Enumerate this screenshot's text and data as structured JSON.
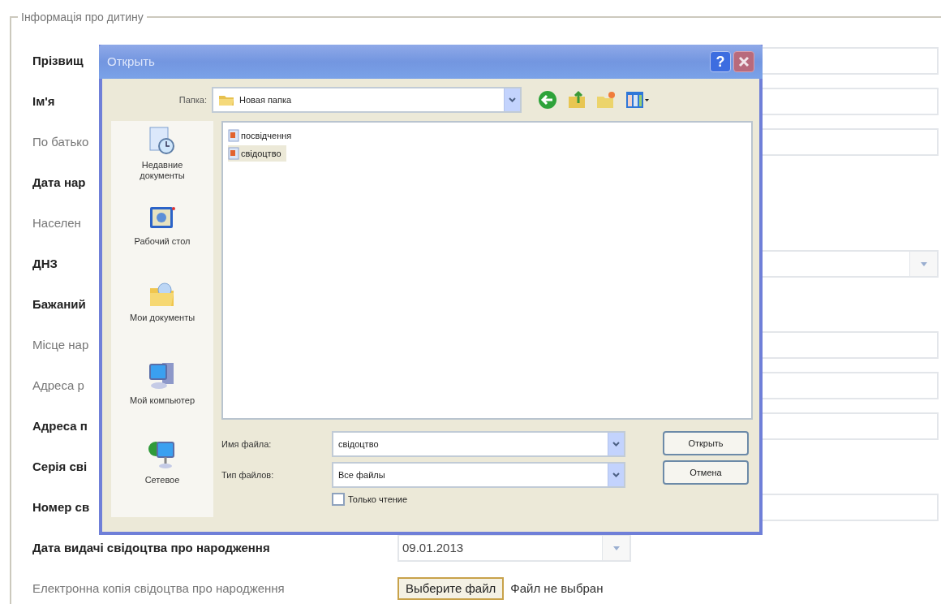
{
  "form": {
    "legend": "Інформація про дитину",
    "rows": [
      {
        "label": "Прізвищ",
        "required": true,
        "control": {
          "kind": "text"
        }
      },
      {
        "label": "Ім'я",
        "required": true,
        "control": {
          "kind": "text"
        }
      },
      {
        "label": "По батько",
        "required": false,
        "control": {
          "kind": "text"
        }
      },
      {
        "label": "Дата нар",
        "required": true,
        "control": {
          "kind": "none"
        }
      },
      {
        "label": "Населен",
        "required": false,
        "control": {
          "kind": "none"
        }
      },
      {
        "label": "ДНЗ",
        "required": true,
        "control": {
          "kind": "select"
        }
      },
      {
        "label": "Бажаний",
        "required": true,
        "control": {
          "kind": "none"
        }
      },
      {
        "label": "Місце нар",
        "required": false,
        "control": {
          "kind": "text"
        }
      },
      {
        "label": "Адреса р",
        "required": false,
        "control": {
          "kind": "text"
        }
      },
      {
        "label": "Адреса п",
        "required": true,
        "control": {
          "kind": "text"
        }
      },
      {
        "label": "Серія сві",
        "required": true,
        "control": {
          "kind": "none"
        }
      },
      {
        "label": "Номер св",
        "required": true,
        "control": {
          "kind": "text"
        }
      },
      {
        "label": "Дата видачі свідоцтва про народження",
        "required": true,
        "control": {
          "kind": "date",
          "value": "09.01.2013"
        }
      },
      {
        "label": "Електронна копія свідоцтва про народження",
        "required": false,
        "control": {
          "kind": "file",
          "button": "Выберите файл",
          "status": "Файл не выбран"
        }
      }
    ]
  },
  "dialog": {
    "title": "Открыть",
    "help": "?",
    "folder_label": "Папка:",
    "folder": "Новая папка",
    "places": [
      {
        "label": "Недавние документы",
        "kind": "recent"
      },
      {
        "label": "Рабочий стол",
        "kind": "desktop"
      },
      {
        "label": "Мои документы",
        "kind": "documents"
      },
      {
        "label": "Мой компьютер",
        "kind": "computer"
      },
      {
        "label": "Сетевое",
        "kind": "network"
      }
    ],
    "files": [
      {
        "name": "посвідчення",
        "selected": false
      },
      {
        "name": "свідоцтво",
        "selected": true
      }
    ],
    "file_name_label": "Имя файла:",
    "file_name": "свідоцтво",
    "file_type_label": "Тип файлов:",
    "file_type": "Все файлы",
    "read_only": {
      "label": "Только чтение",
      "checked": false
    },
    "open_button": "Открыть",
    "cancel_button": "Отмена"
  }
}
